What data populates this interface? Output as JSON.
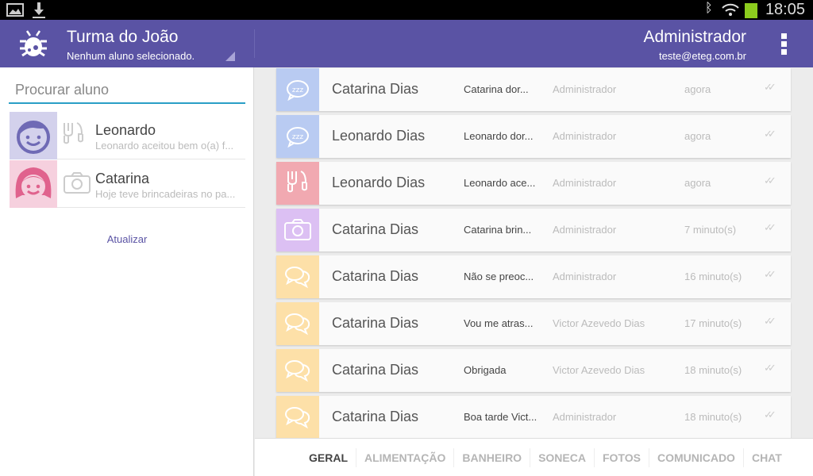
{
  "status": {
    "time": "18:05",
    "icons": [
      "image-icon",
      "download-icon",
      "bluetooth-icon",
      "wifi-icon",
      "battery-icon"
    ]
  },
  "header": {
    "title": "Turma do João",
    "subtitle": "Nenhum aluno selecionado.",
    "user": "Administrador",
    "email": "teste@eteg.com.br",
    "color": "#5a53a4"
  },
  "sidebar": {
    "search_placeholder": "Procurar aluno",
    "refresh": "Atualizar",
    "students": [
      {
        "name": "Leonardo",
        "message": "Leonardo aceitou bem o(a) f...",
        "avatar": "boy",
        "icon": "food-icon",
        "color": "#d3d1ec"
      },
      {
        "name": "Catarina",
        "message": "Hoje teve brincadeiras no pa...",
        "avatar": "girl",
        "icon": "camera-icon",
        "color": "#f6d0de"
      }
    ]
  },
  "feed": [
    {
      "name": "Catarina Dias",
      "message": "Catarina dor...",
      "author": "Administrador",
      "time": "agora",
      "icon": "sleep",
      "color": "#b9cbf2"
    },
    {
      "name": "Leonardo Dias",
      "message": "Leonardo dor...",
      "author": "Administrador",
      "time": "agora",
      "icon": "sleep",
      "color": "#b9cbf2"
    },
    {
      "name": "Leonardo Dias",
      "message": "Leonardo ace...",
      "author": "Administrador",
      "time": "agora",
      "icon": "food",
      "color": "#f1a9b1"
    },
    {
      "name": "Catarina Dias",
      "message": "Catarina brin...",
      "author": "Administrador",
      "time": "7 minuto(s)",
      "icon": "camera",
      "color": "#dcc0f3"
    },
    {
      "name": "Catarina Dias",
      "message": "Não se preoc...",
      "author": "Administrador",
      "time": "16 minuto(s)",
      "icon": "chat",
      "color": "#fde0a8"
    },
    {
      "name": "Catarina Dias",
      "message": "Vou me atras...",
      "author": "Victor Azevedo Dias",
      "time": "17 minuto(s)",
      "icon": "chat",
      "color": "#fde0a8"
    },
    {
      "name": "Catarina Dias",
      "message": "Obrigada",
      "author": "Victor Azevedo Dias",
      "time": "18 minuto(s)",
      "icon": "chat",
      "color": "#fde0a8"
    },
    {
      "name": "Catarina Dias",
      "message": "Boa tarde Vict...",
      "author": "Administrador",
      "time": "18 minuto(s)",
      "icon": "chat",
      "color": "#fde0a8"
    }
  ],
  "tabs": [
    {
      "label": "GERAL",
      "active": true
    },
    {
      "label": "ALIMENTAÇÃO"
    },
    {
      "label": "BANHEIRO"
    },
    {
      "label": "SONECA"
    },
    {
      "label": "FOTOS"
    },
    {
      "label": "COMUNICADO"
    },
    {
      "label": "CHAT"
    }
  ]
}
